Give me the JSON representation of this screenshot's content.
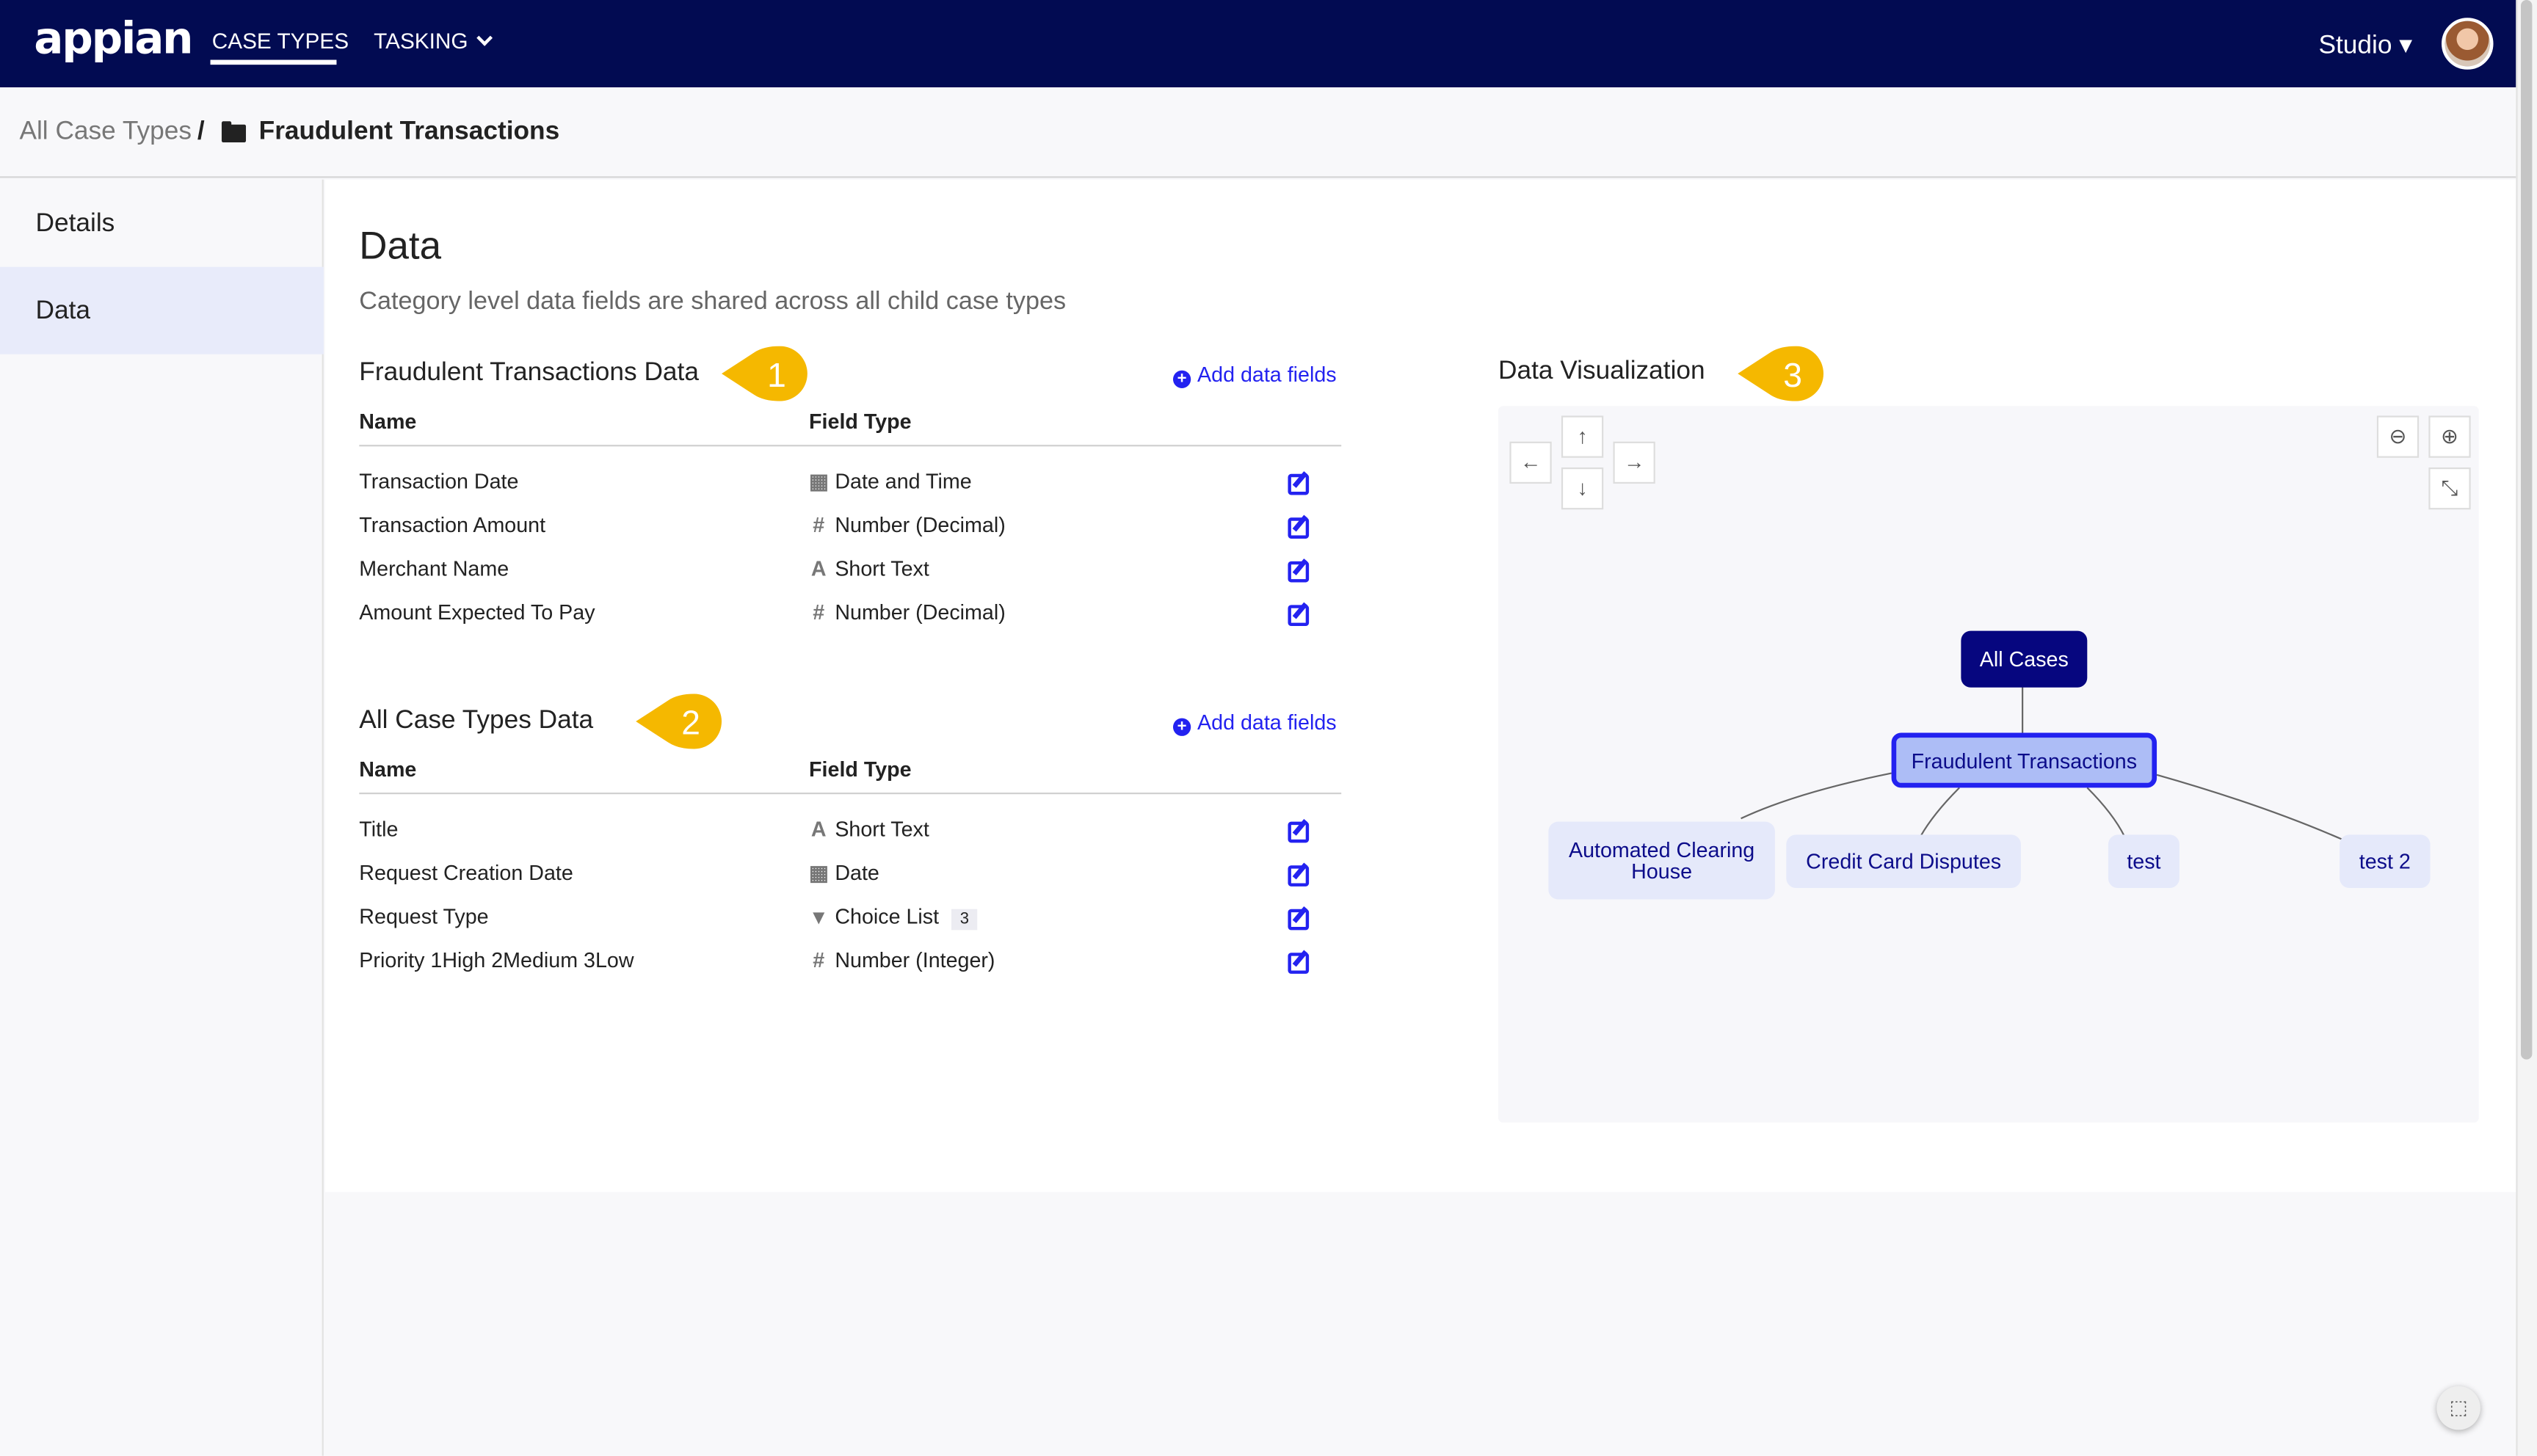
{
  "header": {
    "logo": "appian",
    "nav": [
      {
        "label": "CASE TYPES",
        "active": true
      },
      {
        "label": "TASKING",
        "chevron": "chevron-down-icon"
      }
    ],
    "studio": "Studio ▾",
    "brand_color": "#020b52"
  },
  "breadcrumb": {
    "root": "All Case Types",
    "separator": "/",
    "current": "Fraudulent Transactions"
  },
  "sidebar": {
    "items": [
      {
        "label": "Details"
      },
      {
        "label": "Data",
        "selected": true
      }
    ]
  },
  "main": {
    "title": "Data",
    "subtitle": "Category level data fields are shared across all child case types",
    "sections": [
      {
        "title": "Fraudulent Transactions Data",
        "callout": "1",
        "add_label": "Add data fields",
        "col_name": "Name",
        "col_type": "Field Type",
        "rows": [
          {
            "name": "Transaction Date",
            "icon": "▦",
            "type": "Date and Time"
          },
          {
            "name": "Transaction Amount",
            "icon": "#",
            "type": "Number (Decimal)"
          },
          {
            "name": "Merchant Name",
            "icon": "A",
            "type": "Short Text"
          },
          {
            "name": "Amount Expected To Pay",
            "icon": "#",
            "type": "Number (Decimal)"
          }
        ]
      },
      {
        "title": "All Case Types Data",
        "callout": "2",
        "add_label": "Add data fields",
        "col_name": "Name",
        "col_type": "Field Type",
        "rows": [
          {
            "name": "Title",
            "icon": "A",
            "type": "Short Text"
          },
          {
            "name": "Request Creation Date",
            "icon": "▦",
            "type": "Date"
          },
          {
            "name": "Request Type",
            "icon": "▾",
            "type": "Choice List",
            "badge": "3"
          },
          {
            "name": "Priority 1High 2Medium 3Low",
            "icon": "#",
            "type": "Number (Integer)"
          }
        ]
      }
    ]
  },
  "viz": {
    "title": "Data Visualization",
    "callout": "3",
    "root": "All Cases",
    "selected": "Fraudulent Transactions",
    "children": [
      "Automated Clearing House",
      "Credit Card Disputes",
      "test",
      "test 2"
    ],
    "callout_color": "#f5b800",
    "accent": "#2322f0"
  }
}
